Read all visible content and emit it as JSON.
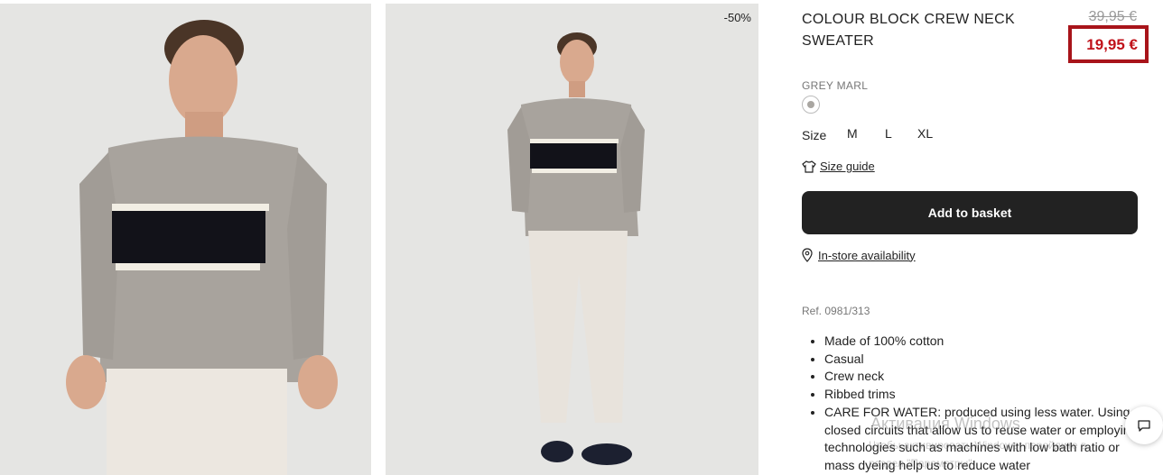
{
  "images": {
    "discount_badge": "-50%"
  },
  "product": {
    "title": "COLOUR BLOCK CREW NECK SWEATER",
    "old_price": "39,95 €",
    "sale_price": "19,95 €",
    "color_name": "GREY MARL",
    "size_label": "Size",
    "sizes": [
      "M",
      "L",
      "XL"
    ],
    "size_guide_label": "Size guide",
    "add_button_label": "Add to basket",
    "instore_label": "In-store availability",
    "reference": "Ref. 0981/313",
    "features": [
      "Made of 100% cotton",
      "Casual",
      "Crew neck",
      "Ribbed trims",
      "CARE FOR WATER: produced using less water. Using closed circuits that allow us to reuse water or employing technologies such as machines with low bath ratio or mass dyeing help us to reduce water"
    ]
  },
  "overlay": {
    "watermark_title": "Активация Windows",
    "watermark_line1": "Чтобы активировать Windows, перейдите в",
    "watermark_line2": "раздел \"Параметры\"."
  },
  "colors": {
    "sale_red": "#c0121a",
    "button_dark": "#222222",
    "image_bg": "#e5e5e3"
  }
}
